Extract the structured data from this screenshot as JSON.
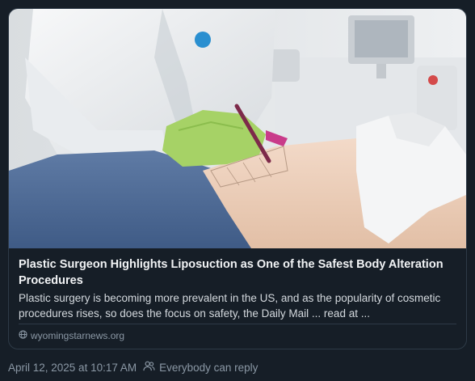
{
  "link_card": {
    "title": "Plastic Surgeon Highlights Liposuction as One of the Safest Body Alteration Procedures",
    "description": "Plastic surgery is becoming more prevalent in the US, and as the popularity of cosmetic procedures rises, so does the focus on safety, the Daily Mail ... read at ...",
    "domain": "wyomingstarnews.org",
    "domain_icon": "globe-icon",
    "image_subject": "surgeon-marking-patient-photo"
  },
  "post_meta": {
    "timestamp": "April 12, 2025 at 10:17 AM",
    "reply_setting": "Everybody can reply",
    "reply_icon": "people-icon"
  },
  "colors": {
    "background": "#161e27",
    "border": "#2e3a47",
    "title_text": "#f1f3f5",
    "muted_text": "#8b98a5"
  }
}
